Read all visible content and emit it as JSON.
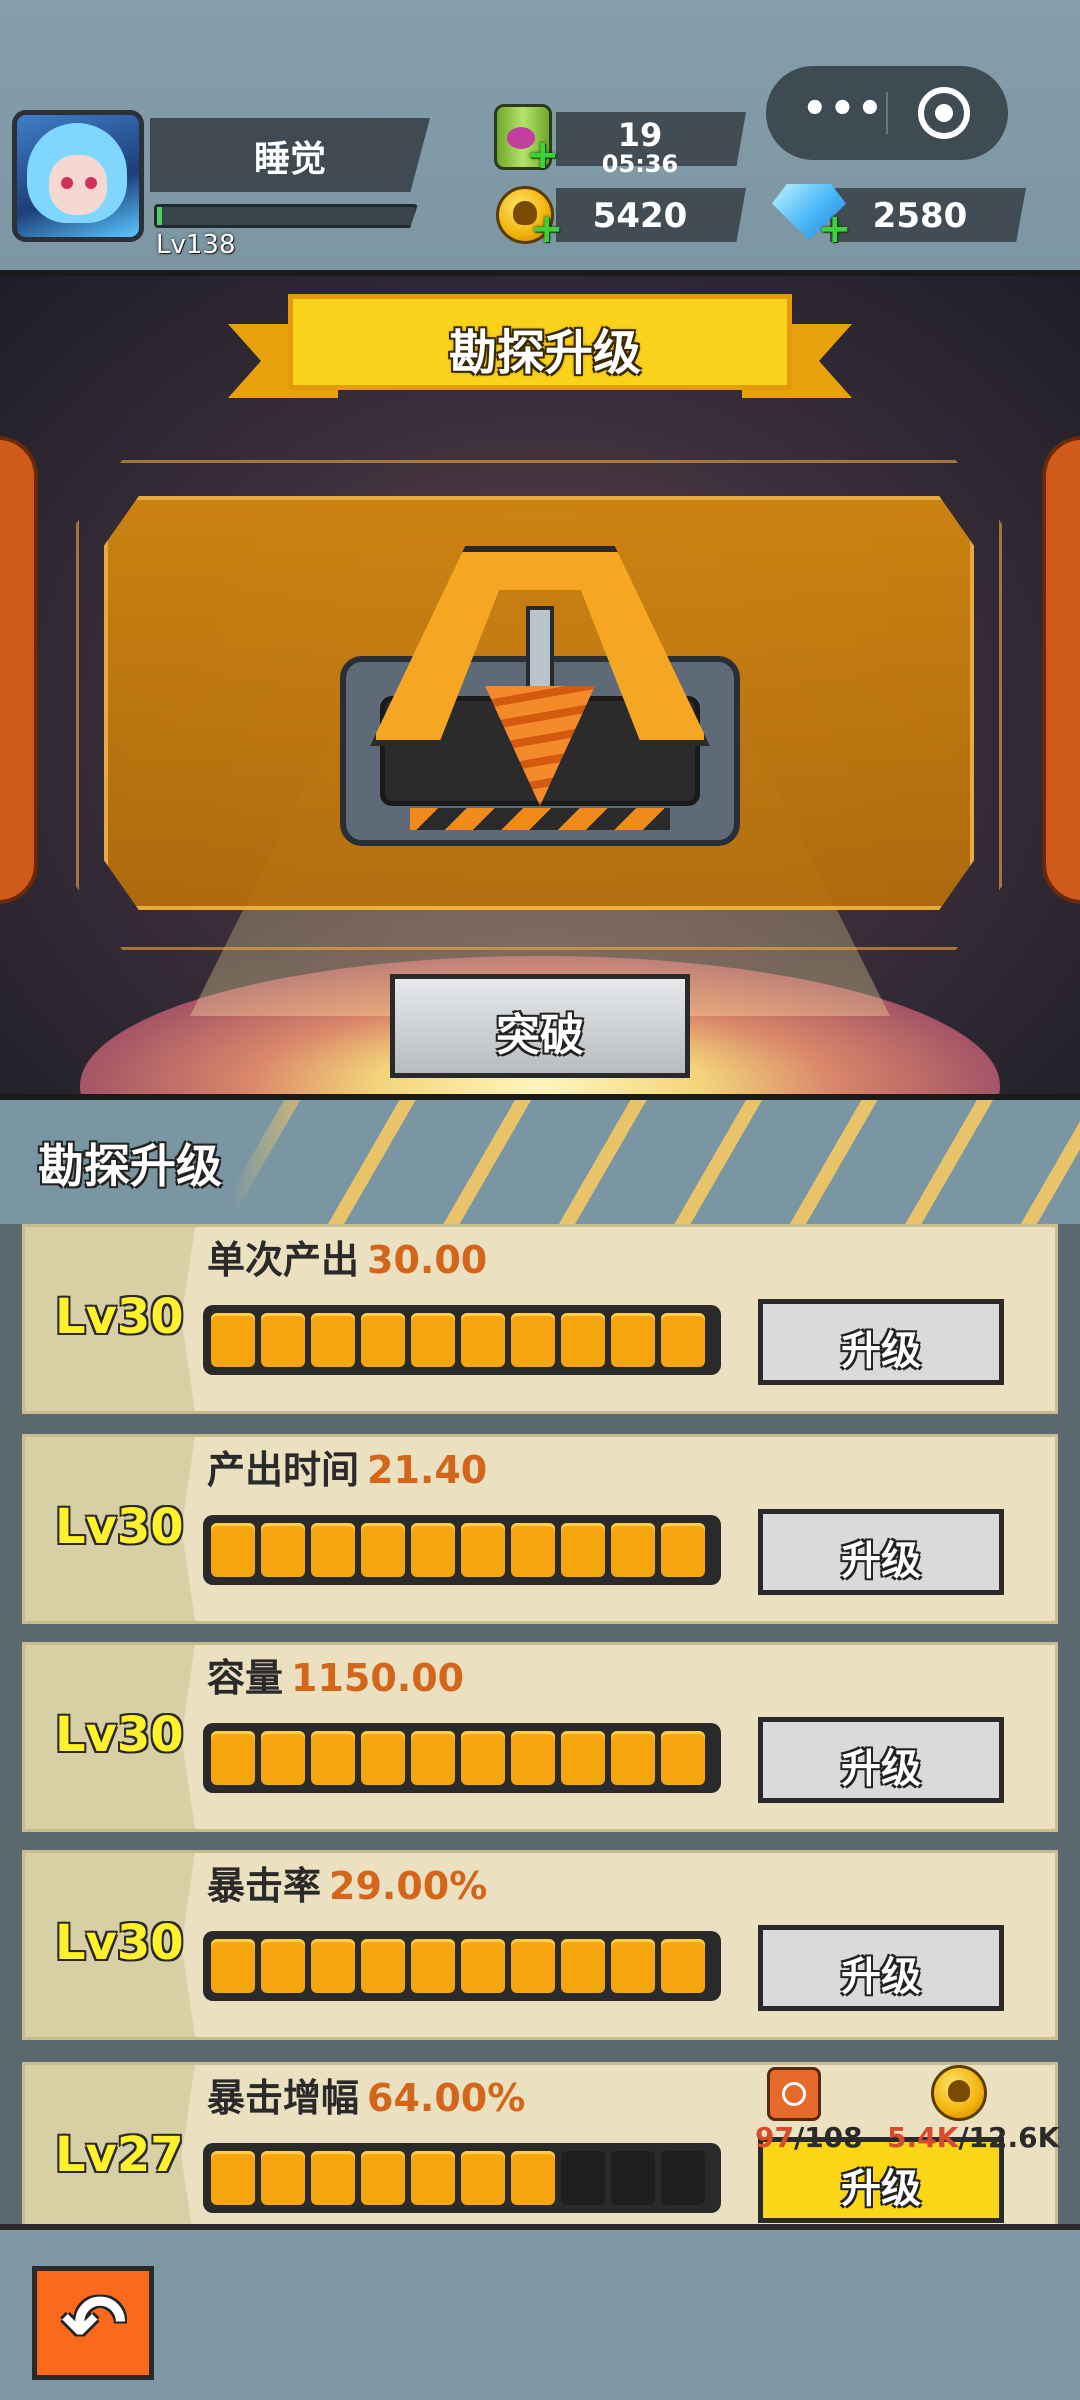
{
  "player": {
    "name": "睡觉",
    "level": "Lv138",
    "xp_fraction": 0.02
  },
  "resources": {
    "energy": {
      "value": "19",
      "timer": "05:36",
      "icon": "energy-can-icon"
    },
    "coins": {
      "value": "5420",
      "icon": "skull-coin-icon"
    },
    "gems": {
      "value": "2580",
      "icon": "diamond-icon"
    }
  },
  "capsule": {
    "more": "•••",
    "more_icon": "more-icon",
    "close_icon": "target-icon"
  },
  "scene": {
    "banner_title": "勘探升级",
    "breakthrough_label": "突破"
  },
  "section": {
    "title": "勘探升级"
  },
  "upgrades": [
    {
      "level": "Lv30",
      "label": "单次产出",
      "value": "30.00",
      "filled": 10,
      "total": 10,
      "button": "升级",
      "button_color": "#d9dadb"
    },
    {
      "level": "Lv30",
      "label": "产出时间",
      "value": "21.40",
      "filled": 10,
      "total": 10,
      "button": "升级",
      "button_color": "#d9dadb"
    },
    {
      "level": "Lv30",
      "label": "容量",
      "value": "1150.00",
      "filled": 10,
      "total": 10,
      "button": "升级",
      "button_color": "#d9dadb"
    },
    {
      "level": "Lv30",
      "label": "暴击率",
      "value": "29.00%",
      "filled": 10,
      "total": 10,
      "button": "升级",
      "button_color": "#d9dadb"
    },
    {
      "level": "Lv27",
      "label": "暴击增幅",
      "value": "64.00%",
      "filled": 7,
      "total": 10,
      "button": "升级",
      "button_color": "#fbd617",
      "cost": {
        "material_have": "97",
        "material_need": "/108",
        "coin_have": "5.4K",
        "coin_need": "/12.6K"
      }
    }
  ],
  "bottom": {
    "back_icon": "back-arrow-icon",
    "back_glyph": "↶"
  },
  "colors": {
    "accent_orange": "#d4661c",
    "level_yellow": "#fff12b",
    "bar_orange": "#f6a60e"
  }
}
